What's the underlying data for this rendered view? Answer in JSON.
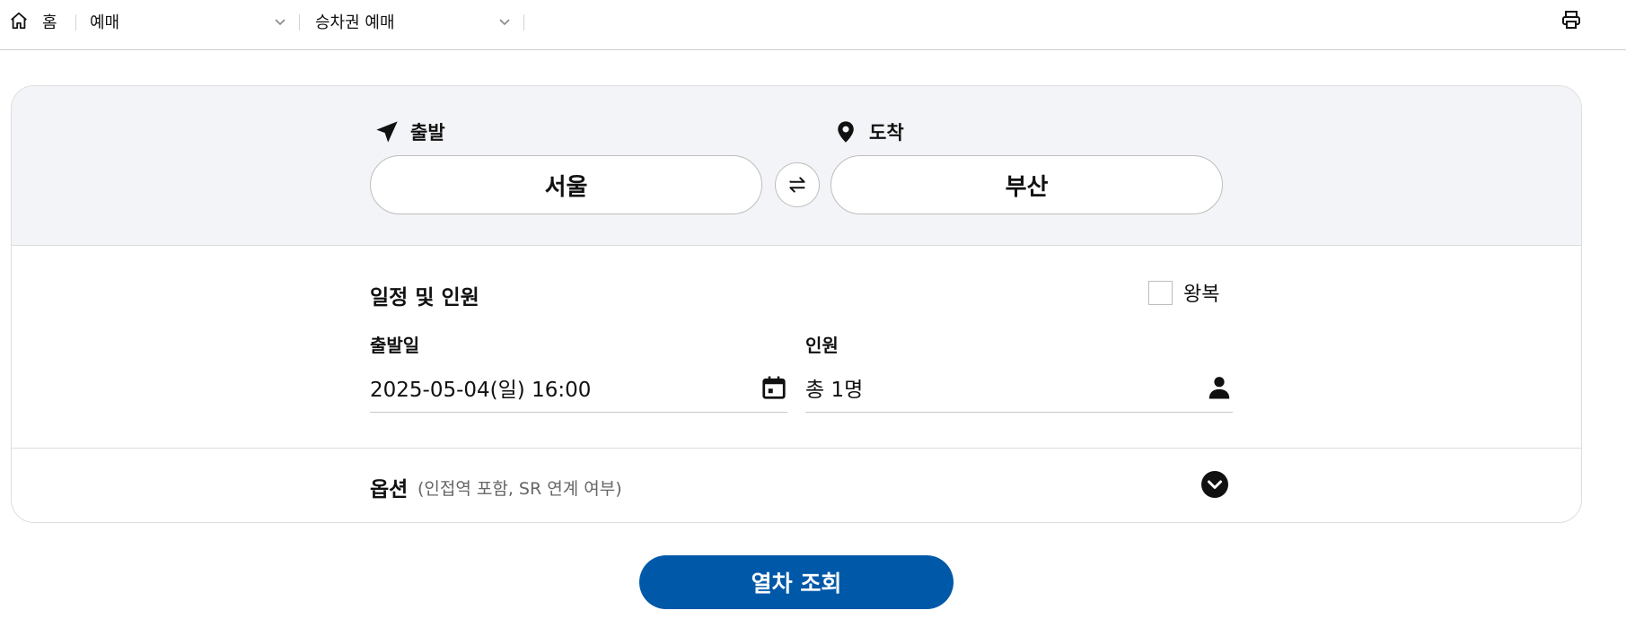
{
  "breadcrumb": {
    "home_label": "홈",
    "crumb1": "예매",
    "crumb2": "승차권 예매"
  },
  "route": {
    "departure_label": "출발",
    "departure_value": "서울",
    "arrival_label": "도착",
    "arrival_value": "부산"
  },
  "schedule": {
    "title": "일정 및 인원",
    "roundtrip_label": "왕복",
    "roundtrip_checked": false,
    "date_label": "출발일",
    "date_value": "2025-05-04(일) 16:00",
    "passenger_label": "인원",
    "passenger_value": "총 1명"
  },
  "options": {
    "title": "옵션",
    "subtitle": "(인접역 포함, SR 연계 여부)"
  },
  "search_button": "열차 조회",
  "colors": {
    "primary": "#0058a8",
    "route_bg": "#f3f4f7"
  },
  "icons": [
    "home-icon",
    "chevron-down-icon",
    "print-icon",
    "navigation-arrow-icon",
    "map-pin-icon",
    "swap-icon",
    "calendar-icon",
    "person-icon",
    "chevron-circle-down-icon"
  ]
}
